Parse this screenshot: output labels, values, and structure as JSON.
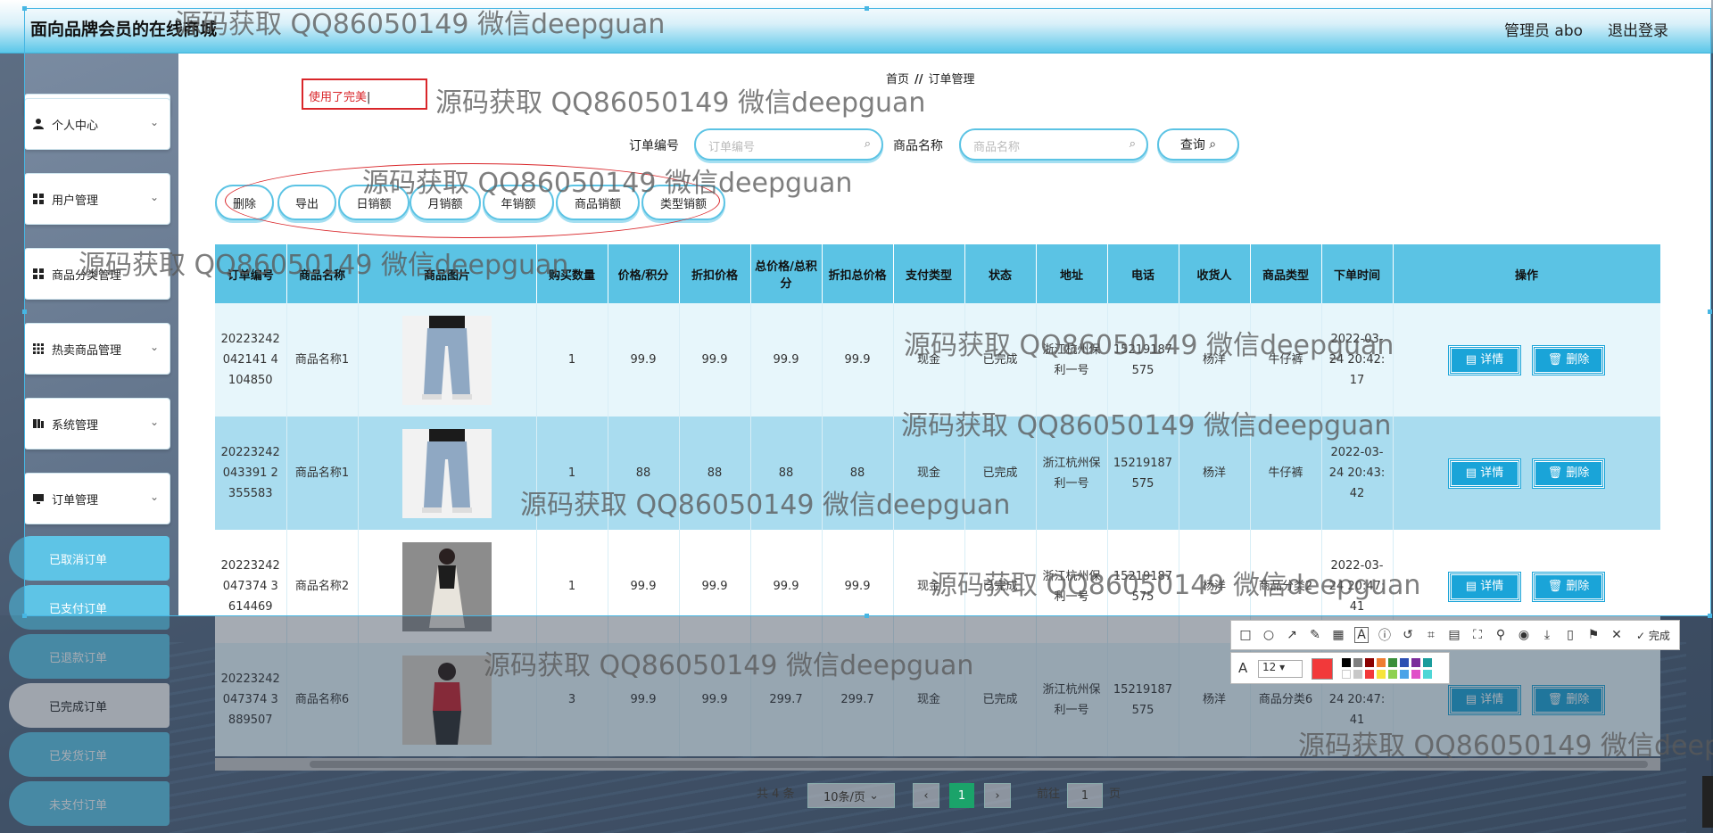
{
  "header": {
    "brand": "面向品牌会员的在线商城",
    "admin": "管理员 abo",
    "logout": "退出登录"
  },
  "sidebar": {
    "items": [
      {
        "label": "个人中心"
      },
      {
        "label": "用户管理"
      },
      {
        "label": "商品分类管理"
      },
      {
        "label": "热卖商品管理"
      },
      {
        "label": "系统管理"
      },
      {
        "label": "订单管理"
      }
    ],
    "sub_items": [
      {
        "label": "已取消订单"
      },
      {
        "label": "已支付订单"
      },
      {
        "label": "已退款订单"
      },
      {
        "label": "已完成订单"
      },
      {
        "label": "已发货订单"
      },
      {
        "label": "未支付订单"
      }
    ]
  },
  "breadcrumb": {
    "home": "首页",
    "sep": "//",
    "current": "订单管理"
  },
  "annotation_text": "使用了完美",
  "search": {
    "order_no_label": "订单编号",
    "order_no_placeholder": "订单编号",
    "product_name_label": "商品名称",
    "product_name_placeholder": "商品名称",
    "query_label": "查询"
  },
  "actions": [
    "删除",
    "导出",
    "日销额",
    "月销额",
    "年销额",
    "商品销额",
    "类型销额"
  ],
  "table": {
    "headers": [
      "订单编号",
      "商品名称",
      "商品图片",
      "购买数量",
      "价格/积分",
      "折扣价格",
      "总价格/总积分",
      "折扣总价格",
      "支付类型",
      "状态",
      "地址",
      "电话",
      "收货人",
      "商品类型",
      "下单时间",
      "操作"
    ],
    "rows": [
      {
        "order_no": "20223242042141 4104850",
        "name": "商品名称1",
        "qty": "1",
        "price": "99.9",
        "discount": "99.9",
        "total": "99.9",
        "discount_total": "99.9",
        "pay": "现金",
        "status": "已完成",
        "addr": "浙江杭州保利一号",
        "phone": "15219187575",
        "receiver": "杨洋",
        "type": "牛仔裤",
        "time": "2022-03-24 20:42:17",
        "img": "jeans"
      },
      {
        "order_no": "20223242043391 2355583",
        "name": "商品名称1",
        "qty": "1",
        "price": "88",
        "discount": "88",
        "total": "88",
        "discount_total": "88",
        "pay": "现金",
        "status": "已完成",
        "addr": "浙江杭州保利一号",
        "phone": "15219187575",
        "receiver": "杨洋",
        "type": "牛仔裤",
        "time": "2022-03-24 20:43:42",
        "img": "jeans"
      },
      {
        "order_no": "20223242047374 3614469",
        "name": "商品名称2",
        "qty": "1",
        "price": "99.9",
        "discount": "99.9",
        "total": "99.9",
        "discount_total": "99.9",
        "pay": "现金",
        "status": "已完成",
        "addr": "浙江杭州保利一号",
        "phone": "15219187575",
        "receiver": "杨洋",
        "type": "商品分类2",
        "time": "2022-03-24 20:47:41",
        "img": "dress"
      },
      {
        "order_no": "20223242047374 3889507",
        "name": "商品名称6",
        "qty": "3",
        "price": "99.9",
        "discount": "99.9",
        "total": "299.7",
        "discount_total": "299.7",
        "pay": "现金",
        "status": "已完成",
        "addr": "浙江杭州保利一号",
        "phone": "15219187575",
        "receiver": "杨洋",
        "type": "商品分类6",
        "time": "2022-03-24 20:47:41",
        "img": "red"
      }
    ],
    "detail_label": "详情",
    "delete_label": "删除"
  },
  "pagination": {
    "total": "共 4 条",
    "page_size": "10条/页",
    "current": "1",
    "goto": "前往",
    "goto_value": "1",
    "page_unit": "页"
  },
  "snip_tool": {
    "font_size": "12",
    "done_label": "完成"
  },
  "watermark": "源码获取 QQ86050149 微信deepguan",
  "watermark_cut": "源码获取 QQ86050149 微信deep"
}
